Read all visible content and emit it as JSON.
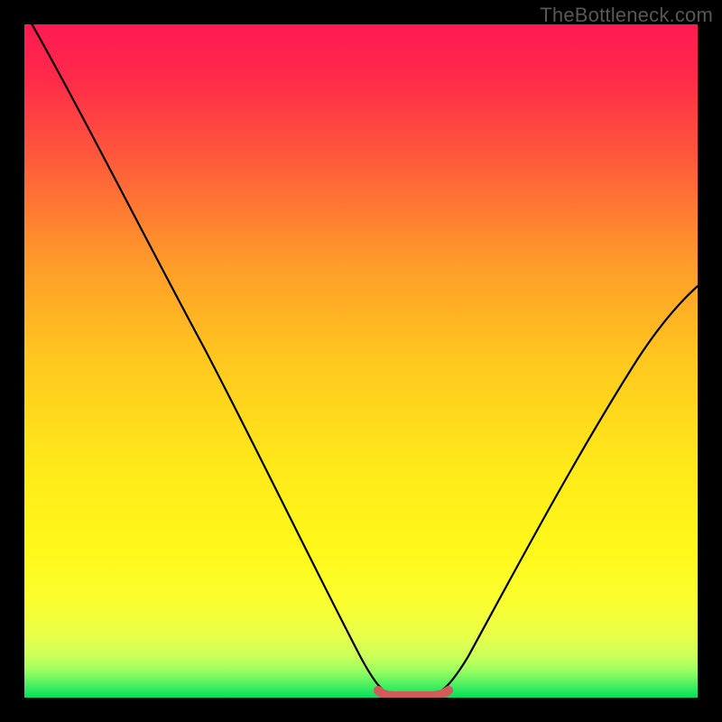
{
  "watermark": "TheBottleneck.com",
  "chart_data": {
    "type": "line",
    "title": "",
    "xlabel": "",
    "ylabel": "",
    "xlim": [
      0,
      1
    ],
    "ylim": [
      0,
      1
    ],
    "colors": {
      "top_gradient": "#ff2050",
      "mid_gradient": "#ffe800",
      "bottom_band": "#00e060",
      "curve": "#000000",
      "marker": "#d15a5a",
      "background_outside": "#000000"
    },
    "series": [
      {
        "name": "bottleneck-curve",
        "type": "line",
        "x": [
          0.0,
          0.05,
          0.1,
          0.15,
          0.2,
          0.25,
          0.3,
          0.35,
          0.4,
          0.45,
          0.5,
          0.525,
          0.55,
          0.6,
          0.625,
          0.65,
          0.7,
          0.75,
          0.8,
          0.85,
          0.9,
          0.95,
          1.0
        ],
        "values": [
          1.02,
          0.92,
          0.82,
          0.72,
          0.62,
          0.52,
          0.42,
          0.32,
          0.22,
          0.12,
          0.03,
          0.005,
          0.0,
          0.0,
          0.005,
          0.03,
          0.11,
          0.2,
          0.29,
          0.38,
          0.46,
          0.54,
          0.61
        ]
      },
      {
        "name": "optimal-range-marker",
        "type": "line",
        "x": [
          0.525,
          0.55,
          0.6,
          0.625
        ],
        "values": [
          0.005,
          0.0,
          0.0,
          0.005
        ]
      }
    ],
    "annotations": []
  }
}
